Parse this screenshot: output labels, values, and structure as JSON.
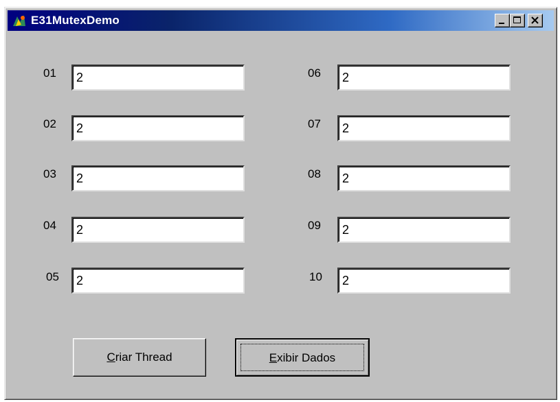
{
  "window": {
    "title": "E31MutexDemo",
    "icon": "app-icon",
    "caption_buttons": [
      "minimize-icon",
      "maximize-icon",
      "close-icon"
    ]
  },
  "fields": [
    {
      "label": "01",
      "value": "2"
    },
    {
      "label": "02",
      "value": "2"
    },
    {
      "label": "03",
      "value": "2"
    },
    {
      "label": "04",
      "value": "2"
    },
    {
      "label": "05",
      "value": "2"
    },
    {
      "label": "06",
      "value": "2"
    },
    {
      "label": "07",
      "value": "2"
    },
    {
      "label": "08",
      "value": "2"
    },
    {
      "label": "09",
      "value": "2"
    },
    {
      "label": "10",
      "value": "2"
    }
  ],
  "buttons": {
    "create_thread": {
      "accel": "C",
      "rest": "riar Thread"
    },
    "show_data": {
      "accel": "E",
      "rest": "xibir Dados"
    }
  },
  "colors": {
    "face": "#c0c0c0",
    "titlebar_start": "#000080",
    "titlebar_end": "#a6caf0",
    "field_bg": "#ffffff"
  }
}
